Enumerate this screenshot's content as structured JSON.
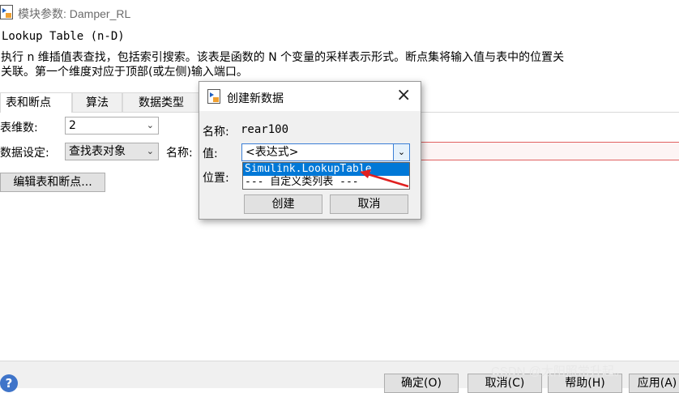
{
  "window": {
    "title": "模块参数: Damper_RL"
  },
  "block": {
    "name": "Lookup Table (n-D)",
    "description_line1": "执行 n 维插值表查找，包括索引搜索。该表是函数的 N 个变量的采样表示形式。断点集将输入值与表中的位置关",
    "description_line2": "关联。第一个维度对应于顶部(或左侧)输入端口。"
  },
  "tabs": [
    {
      "label": "表和断点"
    },
    {
      "label": "算法"
    },
    {
      "label": "数据类型"
    }
  ],
  "form": {
    "dims_label": "表维数:",
    "dims_value": "2",
    "data_spec_label": "数据设定:",
    "data_spec_value": "查找表对象",
    "name_label": "名称:",
    "edit_button": "编辑表和断点..."
  },
  "dialog": {
    "title": "创建新数据",
    "name_label": "名称:",
    "name_value": "rear100",
    "value_label": "值:",
    "value_selected": "<表达式>",
    "location_label": "位置:",
    "options": [
      "Simulink.LookupTable",
      "--- 自定义类列表 ---"
    ],
    "create_button": "创建",
    "cancel_button": "取消",
    "arrow_color": "#e02020"
  },
  "footer": {
    "ok": "确定(O)",
    "cancel": "取消(C)",
    "help": "帮助(H)",
    "apply": "应用(A)"
  },
  "watermark": "CSDN @太阳照常升起。"
}
